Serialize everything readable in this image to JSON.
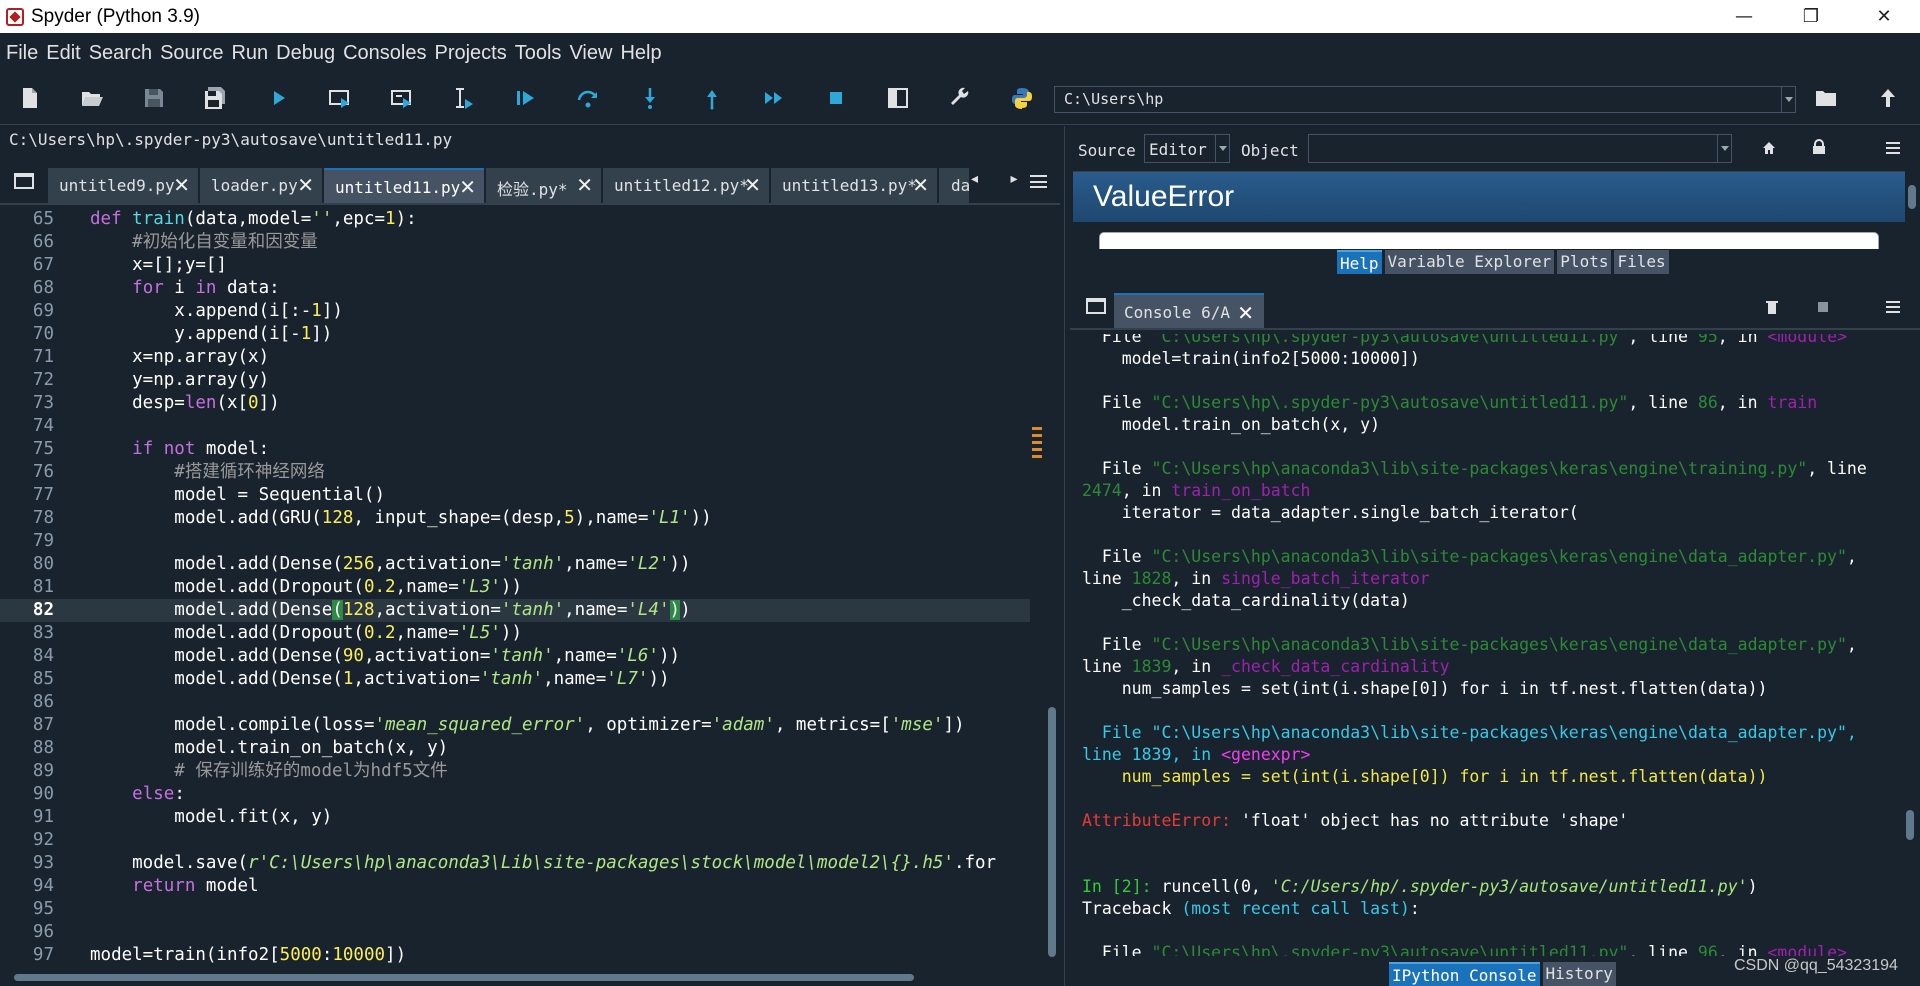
{
  "window": {
    "title": "Spyder (Python 3.9)",
    "min": "—",
    "max": "❐",
    "close": "✕"
  },
  "menu": [
    "File",
    "Edit",
    "Search",
    "Source",
    "Run",
    "Debug",
    "Consoles",
    "Projects",
    "Tools",
    "View",
    "Help"
  ],
  "toolbar": {
    "path": "C:\\Users\\hp",
    "icons": [
      "new-file",
      "open-file",
      "save",
      "save-all",
      "run",
      "run-cell",
      "run-cell-advance",
      "run-selection",
      "debug",
      "step",
      "step-into",
      "step-return",
      "continue",
      "stop",
      "maximize-pane",
      "preferences",
      "python-path-manager"
    ]
  },
  "editor": {
    "file_path": "C:\\Users\\hp\\.spyder-py3\\autosave\\untitled11.py",
    "tabs": [
      {
        "label": "untitled9.py",
        "active": false
      },
      {
        "label": "loader.py",
        "active": false
      },
      {
        "label": "untitled11.py",
        "active": true
      },
      {
        "label": "检验.py*",
        "active": false
      },
      {
        "label": "untitled12.py*",
        "active": false
      },
      {
        "label": "untitled13.py*",
        "active": false
      },
      {
        "label": "da",
        "active": false
      }
    ],
    "tab_arrows": "◂ ▸",
    "current_line": 82
  },
  "help": {
    "source_label": "Source",
    "source_value": "Editor",
    "object_label": "Object",
    "object_value": "",
    "heading": "ValueError",
    "tabs": [
      "Help",
      "Variable Explorer",
      "Plots",
      "Files"
    ],
    "active_tab": "Help"
  },
  "console": {
    "tab_label": "Console 6/A",
    "tabs": [
      "IPython Console",
      "History"
    ],
    "active_tab": "IPython Console"
  },
  "watermark": "CSDN @qq_54323194"
}
